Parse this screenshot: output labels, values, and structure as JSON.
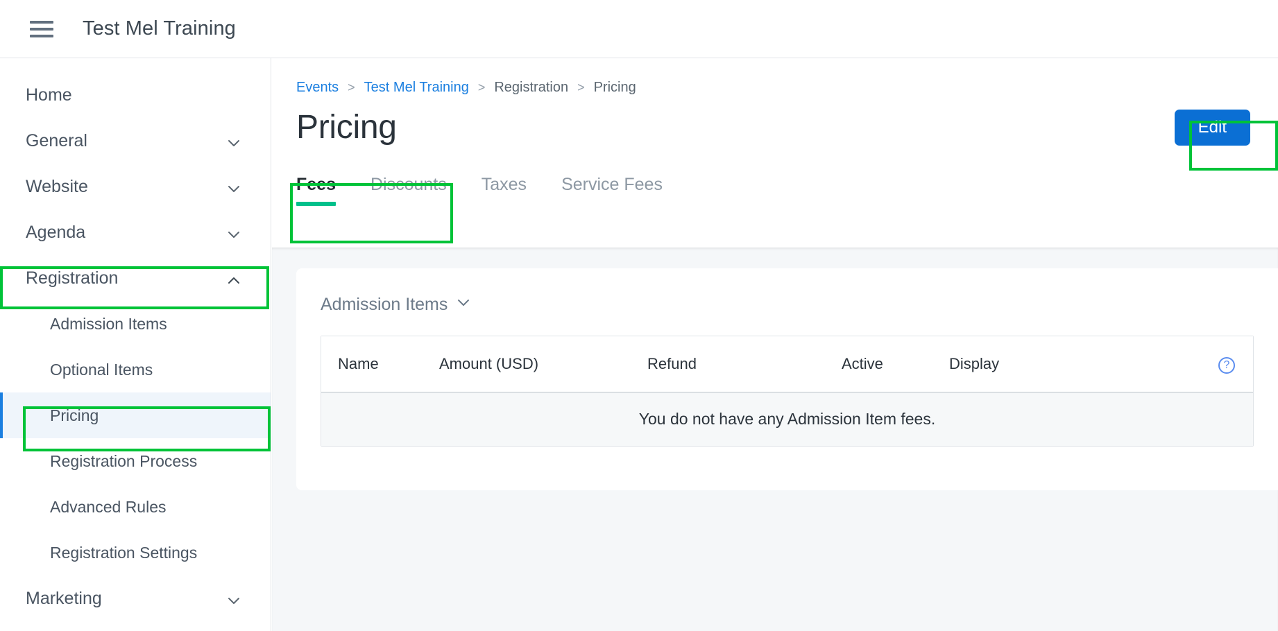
{
  "topbar": {
    "menu_icon": "hamburger-menu-icon",
    "title": "Test Mel Training"
  },
  "sidebar": {
    "items": [
      {
        "label": "Home",
        "level": "top",
        "expandable": false,
        "state": ""
      },
      {
        "label": "General",
        "level": "top",
        "expandable": true,
        "state": "collapsed"
      },
      {
        "label": "Website",
        "level": "top",
        "expandable": true,
        "state": "collapsed"
      },
      {
        "label": "Agenda",
        "level": "top",
        "expandable": true,
        "state": "collapsed"
      },
      {
        "label": "Registration",
        "level": "top",
        "expandable": true,
        "state": "expanded"
      },
      {
        "label": "Admission Items",
        "level": "sub",
        "expandable": false,
        "state": ""
      },
      {
        "label": "Optional Items",
        "level": "sub",
        "expandable": false,
        "state": ""
      },
      {
        "label": "Pricing",
        "level": "sub",
        "expandable": false,
        "state": "active"
      },
      {
        "label": "Registration Process",
        "level": "sub",
        "expandable": false,
        "state": ""
      },
      {
        "label": "Advanced Rules",
        "level": "sub",
        "expandable": false,
        "state": ""
      },
      {
        "label": "Registration Settings",
        "level": "sub",
        "expandable": false,
        "state": ""
      },
      {
        "label": "Marketing",
        "level": "top",
        "expandable": true,
        "state": "collapsed"
      }
    ]
  },
  "breadcrumb": {
    "items": [
      {
        "label": "Events",
        "link": true
      },
      {
        "label": "Test Mel Training",
        "link": true
      },
      {
        "label": "Registration",
        "link": false
      },
      {
        "label": "Pricing",
        "link": false
      }
    ],
    "separator": ">"
  },
  "header": {
    "page_title": "Pricing",
    "edit_label": "Edit"
  },
  "tabs": [
    {
      "label": "Fees",
      "active": true
    },
    {
      "label": "Discounts",
      "active": false
    },
    {
      "label": "Taxes",
      "active": false
    },
    {
      "label": "Service Fees",
      "active": false
    }
  ],
  "card": {
    "section_label": "Admission Items",
    "section_chevron": "chevron-down-icon",
    "help_icon": "help-circle-icon",
    "table": {
      "columns": [
        "Name",
        "Amount (USD)",
        "Refund",
        "Active",
        "Display"
      ],
      "rows": [],
      "empty_message": "You do not have any Admission Item fees."
    }
  },
  "colors": {
    "annotation_green": "#00c338",
    "primary_blue": "#0b6fd4",
    "link_blue": "#1b7fe0",
    "tab_underline_teal": "#00c08b",
    "active_nav_bg": "#eff5fb",
    "active_nav_border": "#1b7fe0",
    "content_bg": "#f5f7f9"
  }
}
